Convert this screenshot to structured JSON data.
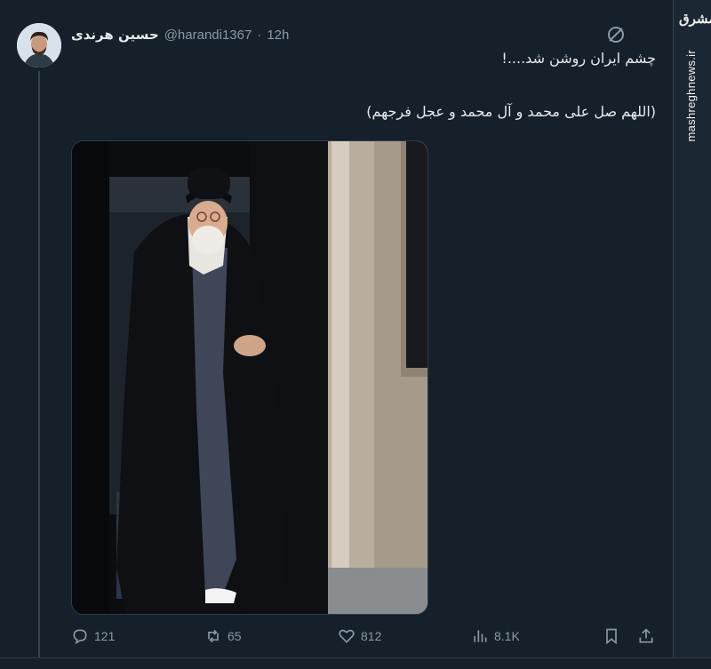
{
  "tweet": {
    "display_name": "حسین هرندی",
    "handle": "@harandi1367",
    "separator": "·",
    "time": "12h",
    "lines": [
      "چشم ایران روشن شد....!",
      "(اللهم صل علی محمد و آل محمد و عجل فرجهم)"
    ]
  },
  "watermark": {
    "logo_text": "مشرق",
    "site": "mashreghnews.ir"
  },
  "actions": {
    "replies": "121",
    "reposts": "65",
    "likes": "812",
    "views": "8.1K"
  },
  "colors": {
    "background": "#15202b",
    "text": "#e7e9ea",
    "muted": "#8b98a5",
    "divider": "#38444d"
  },
  "icons": [
    "grok-icon",
    "reply-icon",
    "repost-icon",
    "like-icon",
    "views-icon",
    "bookmark-icon",
    "share-icon"
  ]
}
